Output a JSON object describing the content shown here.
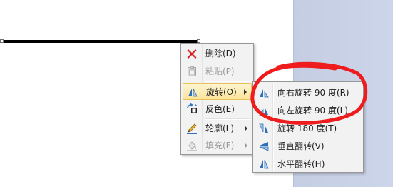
{
  "context_menu": {
    "items": [
      {
        "label": "删除(D)",
        "icon": "delete-x-icon",
        "enabled": true,
        "submenu": false
      },
      {
        "label": "粘贴(P)",
        "icon": "paste-icon",
        "enabled": false,
        "submenu": false
      },
      {
        "label": "旋转(O)",
        "icon": "rotate-icon",
        "enabled": true,
        "submenu": true,
        "highlighted": true
      },
      {
        "label": "反色(E)",
        "icon": "invert-color-icon",
        "enabled": true,
        "submenu": false
      },
      {
        "label": "轮廓(L)",
        "icon": "outline-pen-icon",
        "enabled": true,
        "submenu": true
      },
      {
        "label": "填充(F)",
        "icon": "fill-bucket-icon",
        "enabled": false,
        "submenu": true
      }
    ]
  },
  "rotate_submenu": {
    "items": [
      {
        "label": "向右旋转 90 度(R)",
        "icon": "rotate-right-icon"
      },
      {
        "label": "向左旋转 90 度(L)",
        "icon": "rotate-left-icon"
      },
      {
        "label": "旋转 180 度(T)",
        "icon": "rotate-180-icon"
      },
      {
        "label": "垂直翻转(V)",
        "icon": "flip-vertical-icon"
      },
      {
        "label": "水平翻转(H)",
        "icon": "flip-horizontal-icon"
      }
    ]
  },
  "colors": {
    "highlight": "#fbe59a",
    "annotation": "#ee1c1c",
    "delete_icon": "#d42020",
    "rotate_icon": "#2f6fb8"
  }
}
